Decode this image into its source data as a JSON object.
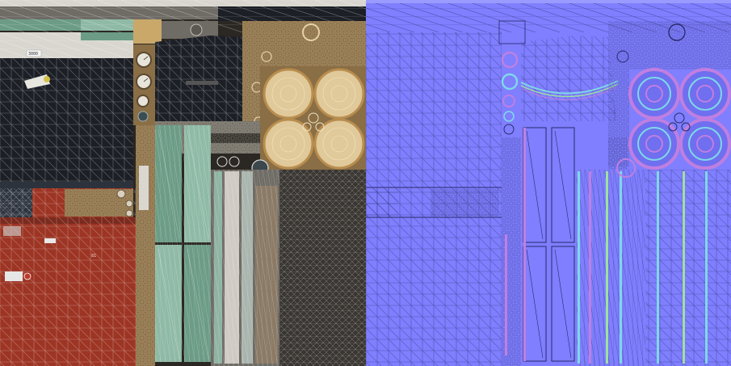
{
  "texture_sheet": {
    "albedo_map": {
      "palette": {
        "background": "#2b2722",
        "dark_panel": "#1c1f26",
        "dark_panel_edge": "#2d333d",
        "red_panel": "#9d3524",
        "red_panel_dark": "#7c2a1e",
        "pale_strip": "#d8d6cf",
        "green_panel": "#6c9c86",
        "green_panel_light": "#8fbaa6",
        "bronze": "#8a6e45",
        "bronze_light": "#c9a86a",
        "fan_face": "#e0c99a",
        "fan_ring": "#b88d4e",
        "metal_grey": "#6f6c66",
        "grate": "#3a3632",
        "wire": "#ffffff"
      },
      "labels": {
        "sticker_top": "3000",
        "panel_mark": "81"
      }
    },
    "normal_map": {
      "palette": {
        "base": "#7f7fff",
        "base_dark": "#6f6ff0",
        "edge_cyan": "#7fd8e6",
        "edge_magenta": "#c07fe0",
        "edge_green": "#9fe0a0",
        "wire": "#2a2a6a"
      }
    }
  }
}
